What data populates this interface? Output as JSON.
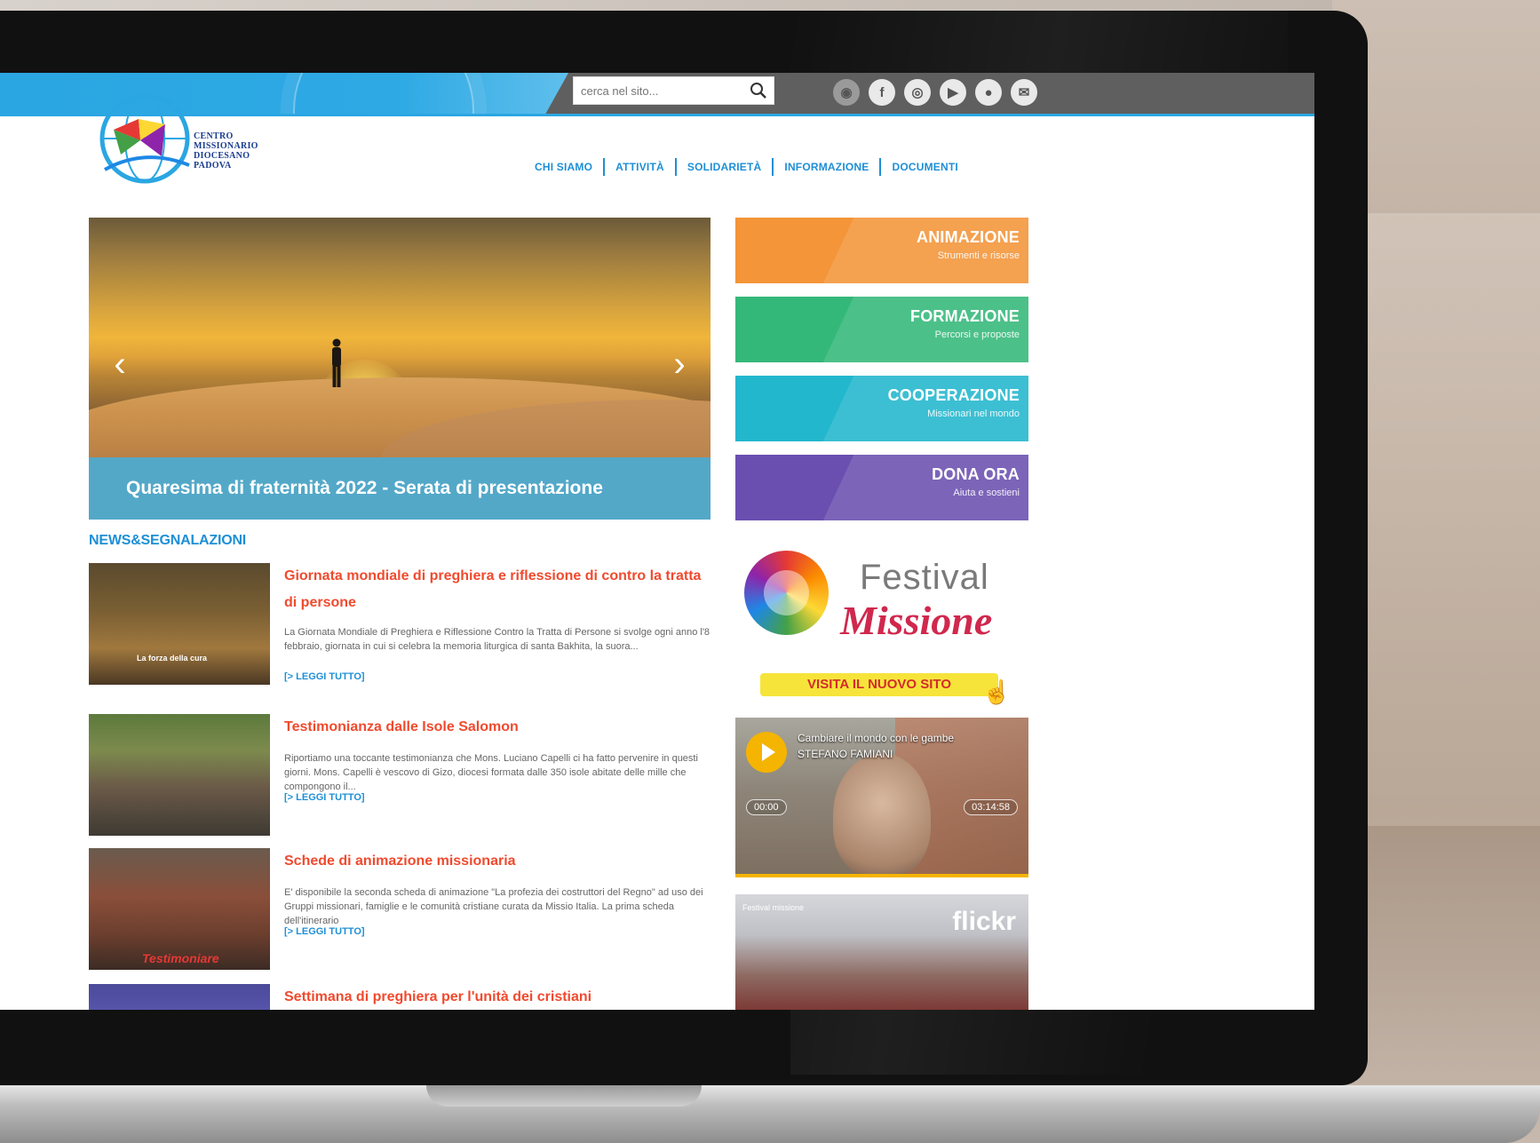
{
  "header": {
    "search_placeholder": "cerca nel sito...",
    "logo_lines": [
      "CENTRO",
      "MISSIONARIO",
      "DIOCESANO",
      "PADOVA"
    ],
    "social_icons": [
      "rss-icon",
      "facebook-icon",
      "instagram-icon",
      "youtube-icon",
      "flickr-icon",
      "email-icon"
    ],
    "social_glyphs": [
      "◉",
      "f",
      "◎",
      "▶",
      "●",
      "✉"
    ]
  },
  "nav": {
    "items": [
      "CHI SIAMO",
      "ATTIVITÀ",
      "SOLIDARIETÀ",
      "INFORMAZIONE",
      "DOCUMENTI"
    ]
  },
  "slider": {
    "caption": "Quaresima di fraternità 2022 - Serata di presentazione",
    "prev": "‹",
    "next": "›"
  },
  "tiles": [
    {
      "title": "ANIMAZIONE",
      "subtitle": "Strumenti e risorse",
      "color": "#f39538"
    },
    {
      "title": "FORMAZIONE",
      "subtitle": "Percorsi e proposte",
      "color": "#34b879"
    },
    {
      "title": "COOPERAZIONE",
      "subtitle": "Missionari nel mondo",
      "color": "#22b7cd"
    },
    {
      "title": "DONA ORA",
      "subtitle": "Aiuta e sostieni",
      "color": "#6a4fb0"
    }
  ],
  "news": {
    "heading": "NEWS&SEGNALAZIONI",
    "more_label": "[> LEGGI TUTTO]",
    "items": [
      {
        "title": "Giornata mondiale di preghiera e riflessione di contro la tratta di persone",
        "body": "La Giornata Mondiale di Preghiera e Riflessione Contro la Tratta di Persone si svolge ogni anno l'8 febbraio, giornata in cui si celebra la memoria liturgica di santa Bakhita, la suora...",
        "thumb_caption": "La forza della cura"
      },
      {
        "title": "Testimonianza dalle Isole Salomon",
        "body": "Riportiamo una toccante testimonianza che Mons. Luciano Capelli ci ha fatto pervenire in questi giorni. Mons. Capelli è vescovo di Gizo, diocesi formata dalle 350 isole abitate delle mille che compongono il..."
      },
      {
        "title": "Schede di animazione missionaria",
        "body": "E' disponibile la seconda scheda di animazione \"La profezia dei costruttori del Regno\" ad uso dei Gruppi missionari, famiglie e le comunità cristiane curata da Missio Italia. La prima scheda dell'itinerario",
        "thumb_caption": "Testimoniare"
      },
      {
        "title": "Settimana di preghiera per l'unità dei cristiani"
      }
    ]
  },
  "festival": {
    "word1": "Festival",
    "word2": "Missione",
    "button": "VISITA IL NUOVO SITO"
  },
  "video": {
    "title": "Cambiare il mondo con le gambe STEFANO FAMIANI",
    "time_current": "00:00",
    "time_total": "03:14:58"
  },
  "flickr": {
    "logo": "flickr",
    "title": "Festival missione"
  }
}
